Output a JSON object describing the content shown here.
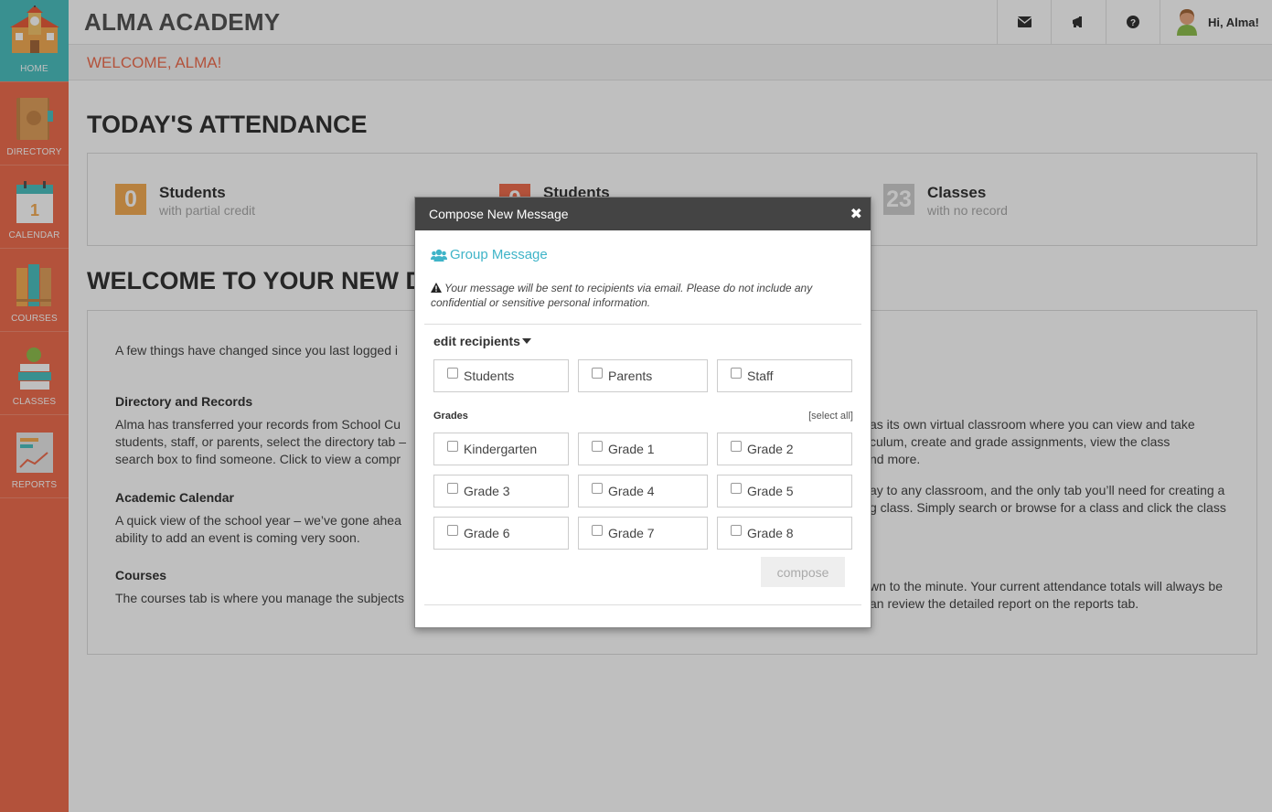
{
  "app": {
    "title": "ALMA ACADEMY"
  },
  "sidebar": {
    "items": [
      {
        "label": "HOME",
        "icon": "school-icon"
      },
      {
        "label": "DIRECTORY",
        "icon": "book-icon"
      },
      {
        "label": "CALENDAR",
        "icon": "calendar-icon",
        "day": "1"
      },
      {
        "label": "COURSES",
        "icon": "books-icon"
      },
      {
        "label": "CLASSES",
        "icon": "apple-books-icon"
      },
      {
        "label": "REPORTS",
        "icon": "chart-icon"
      }
    ]
  },
  "header": {
    "user_greeting": "Hi, Alma!"
  },
  "welcome": {
    "text": "WELCOME, ALMA!"
  },
  "attendance": {
    "title": "TODAY'S ATTENDANCE",
    "stats": [
      {
        "value": "0",
        "title": "Students",
        "subtitle": "with partial credit",
        "color": "#f5ac55"
      },
      {
        "value": "0",
        "title": "Students",
        "subtitle": "",
        "color": "#ef6e4f"
      },
      {
        "value": "23",
        "title": "Classes",
        "subtitle": "with no record",
        "color": "#cfcfcf"
      }
    ]
  },
  "dashboard": {
    "title": "WELCOME TO YOUR NEW D",
    "intro": "A few things have changed since you last logged i",
    "sections": [
      {
        "heading": "Directory and Records",
        "line1": "Alma has transferred your records from School Cu",
        "line2": "students, staff, or parents, select the directory tab –",
        "line3": "search box to find someone. Click to view a compr"
      },
      {
        "heading": "Academic Calendar",
        "line1": "A quick view of the school year – we’ve gone ahea",
        "line2": "ability to add an event is coming very soon."
      },
      {
        "heading": "Courses",
        "line1": "The courses tab is where you manage the subjects"
      }
    ],
    "right_lines": [
      "as its own virtual classroom where you can view and take",
      "culum, create and grade assignments, view the class",
      "nd more.",
      "ay to any classroom, and the only tab you’ll need for creating a",
      "g class. Simply search or browse for a class and click the class",
      "wn to the minute. Your current attendance totals will always be",
      "an review the detailed report on the reports tab."
    ]
  },
  "modal": {
    "title": "Compose New Message",
    "group_message": "Group Message",
    "notice": "Your message will be sent to recipients via email. Please do not include any confidential or sensitive personal information.",
    "edit_recipients": "edit recipients",
    "recipients": [
      "Students",
      "Parents",
      "Staff"
    ],
    "grades_label": "Grades",
    "select_all": "[select all]",
    "grades": [
      "Kindergarten",
      "Grade 1",
      "Grade 2",
      "Grade 3",
      "Grade 4",
      "Grade 5",
      "Grade 6",
      "Grade 7",
      "Grade 8"
    ],
    "compose": "compose"
  }
}
